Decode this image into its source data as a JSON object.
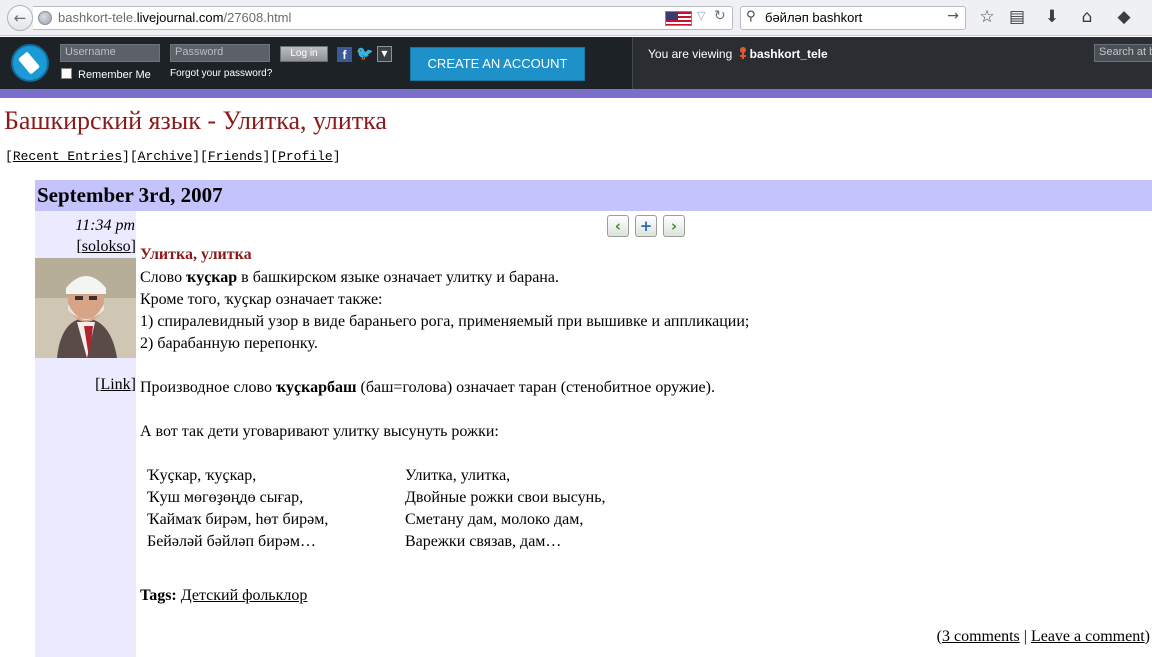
{
  "browser": {
    "url_prefix": "bashkort-tele.",
    "url_host": "livejournal.com",
    "url_path": "/27608.html",
    "search_query": "бәйләп bashkort"
  },
  "lj_header": {
    "username_placeholder": "Username",
    "password_placeholder": "Password",
    "login_label": "Log in",
    "remember_label": "Remember Me",
    "forgot_label": "Forgot your password?",
    "create_account_label": "CREATE AN ACCOUNT",
    "viewing_prefix": "You are viewing",
    "viewing_user": "bashkort_tele",
    "search_placeholder": "Search at b"
  },
  "journal": {
    "title": "Башкирский язык - Улитка, улитка",
    "nav": [
      "Recent Entries",
      "Archive",
      "Friends",
      "Profile"
    ]
  },
  "entry": {
    "date": "September 3rd, 2007",
    "time": "11:34 pm",
    "user": "solokso",
    "link_label": "Link",
    "subject": "Улитка, улитка",
    "p1_prefix": "Слово ",
    "p1_bold": "ҡуҫкар",
    "p1_suffix": " в башкирском языке означает улитку и барана.",
    "p2": "Кроме того, ҡуҫкар означает также:",
    "p3": "1) спиралевидный узор в виде бараньего рога, применяемый при вышивке и аппликации;",
    "p4": "2) барабанную перепонку.",
    "p5_prefix": "Производное слово ",
    "p5_bold": "ҡуҫкарбаш",
    "p5_suffix": " (баш=голова) означает таран (стенобитное оружие).",
    "p6": "А вот так дети уговаривают улитку высунуть рожки:",
    "poem_bashkir": [
      "Ҡуҫкар, ҡуҫкар,",
      "Ҡуш мөгөҙөңдө сығар,",
      "Ҡаймаҡ бирәм, һөт бирәм,",
      "Бейәләй бәйләп бирәм…"
    ],
    "poem_russian": [
      "Улитка, улитка,",
      "Двойные рожки свои высунь,",
      "Сметану дам, молоко дам,",
      "Варежки связав, дам…"
    ],
    "tags_label": "Tags:",
    "tag": "Детский фольклор",
    "comments_label": "3 comments",
    "leave_comment_label": "Leave a comment"
  }
}
